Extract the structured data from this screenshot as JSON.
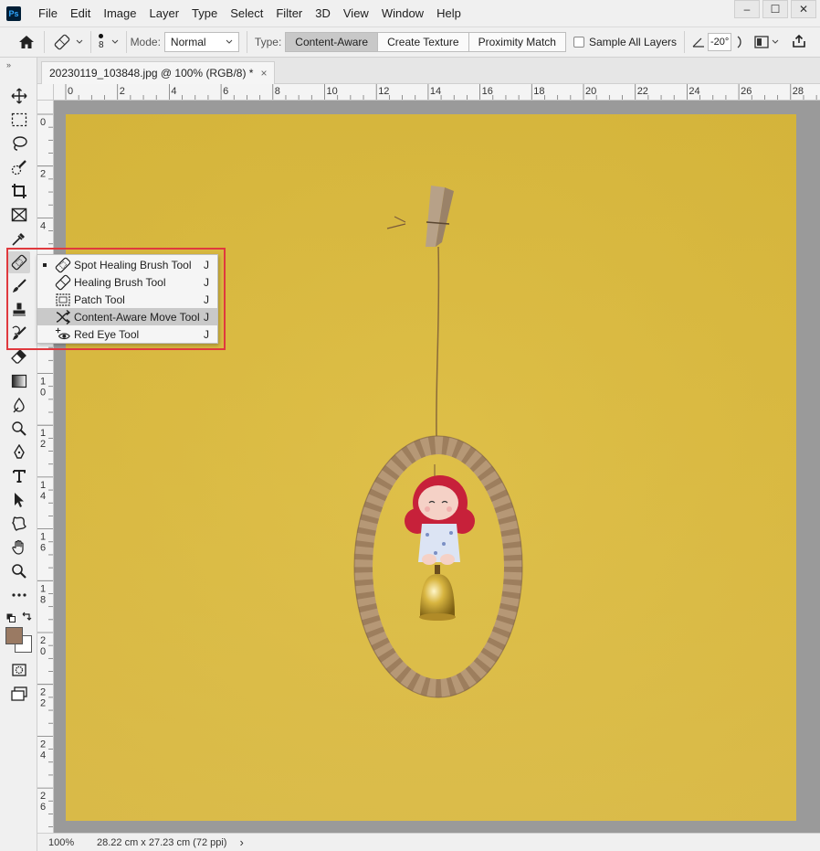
{
  "menubar": {
    "logo": "Ps",
    "items": [
      "File",
      "Edit",
      "Image",
      "Layer",
      "Type",
      "Select",
      "Filter",
      "3D",
      "View",
      "Window",
      "Help"
    ],
    "window_controls": [
      "–",
      "☐",
      "✕"
    ]
  },
  "options": {
    "brush_size": "8",
    "mode_label": "Mode:",
    "mode_value": "Normal",
    "type_label": "Type:",
    "type_buttons": [
      "Content-Aware",
      "Create Texture",
      "Proximity Match"
    ],
    "active_type": "Content-Aware",
    "sample_all_layers_label": "Sample All Layers",
    "sample_all_layers_checked": false,
    "angle_value": "-20°"
  },
  "document": {
    "tab_title": "20230119_103848.jpg @ 100% (RGB/8) *",
    "close": "×"
  },
  "rulers": {
    "top_labels": [
      "0",
      "2",
      "4",
      "6",
      "8",
      "10",
      "12",
      "14",
      "16",
      "18",
      "20",
      "22",
      "24",
      "26",
      "28"
    ],
    "left_labels": [
      "0",
      "2",
      "4",
      "6",
      "8",
      "10",
      "12",
      "14",
      "16",
      "18",
      "20",
      "22",
      "24",
      "26"
    ]
  },
  "flyout": {
    "items": [
      {
        "label": "Spot Healing Brush Tool",
        "shortcut": "J",
        "icon": "spot-healing-brush-icon",
        "current": true,
        "highlighted": false
      },
      {
        "label": "Healing Brush Tool",
        "shortcut": "J",
        "icon": "healing-brush-icon",
        "current": false,
        "highlighted": false
      },
      {
        "label": "Patch Tool",
        "shortcut": "J",
        "icon": "patch-icon",
        "current": false,
        "highlighted": false
      },
      {
        "label": "Content-Aware Move Tool",
        "shortcut": "J",
        "icon": "content-aware-move-icon",
        "current": false,
        "highlighted": true
      },
      {
        "label": "Red Eye Tool",
        "shortcut": "J",
        "icon": "red-eye-icon",
        "current": false,
        "highlighted": false
      }
    ]
  },
  "status": {
    "zoom": "100%",
    "doc_size": "28.22 cm x 27.23 cm (72 ppi)",
    "arrow": "›"
  },
  "colors": {
    "foreground": "#9a7a63",
    "background": "#ffffff",
    "highlight_border": "#e0393e",
    "canvas_yellow": "#dcbd44"
  }
}
